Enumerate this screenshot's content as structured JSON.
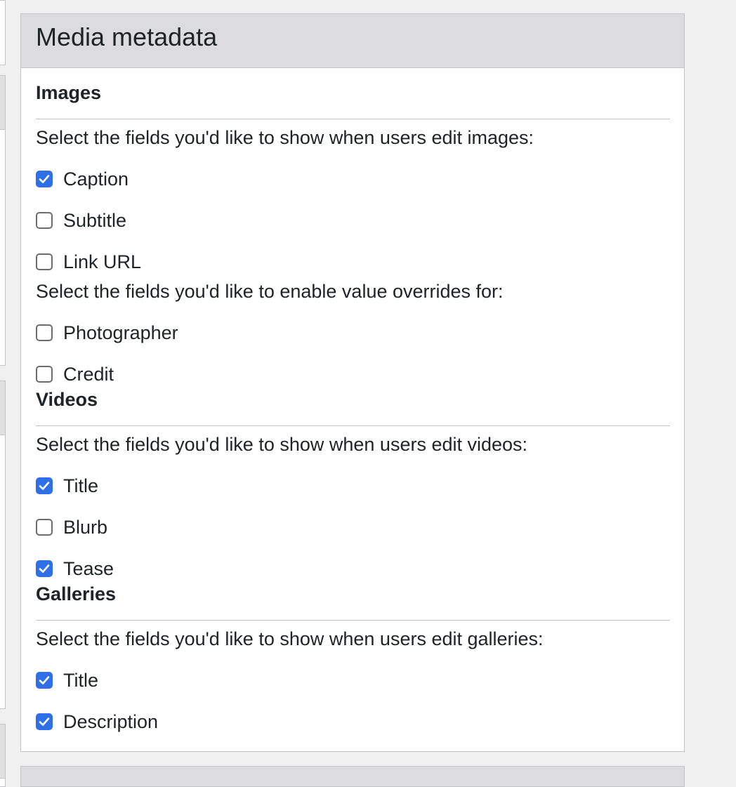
{
  "panel": {
    "title": "Media metadata"
  },
  "images": {
    "heading": "Images",
    "show_prompt": "Select the fields you'd like to show when users edit images:",
    "show_options": [
      {
        "label": "Caption",
        "checked": true
      },
      {
        "label": "Subtitle",
        "checked": false
      },
      {
        "label": "Link URL",
        "checked": false
      }
    ],
    "override_prompt": "Select the fields you'd like to enable value overrides for:",
    "override_options": [
      {
        "label": "Photographer",
        "checked": false
      },
      {
        "label": "Credit",
        "checked": false
      }
    ]
  },
  "videos": {
    "heading": "Videos",
    "show_prompt": "Select the fields you'd like to show when users edit videos:",
    "show_options": [
      {
        "label": "Title",
        "checked": true
      },
      {
        "label": "Blurb",
        "checked": false
      },
      {
        "label": "Tease",
        "checked": true
      }
    ]
  },
  "galleries": {
    "heading": "Galleries",
    "show_prompt": "Select the fields you'd like to show when users edit galleries:",
    "show_options": [
      {
        "label": "Title",
        "checked": true
      },
      {
        "label": "Description",
        "checked": true
      }
    ]
  },
  "colors": {
    "checkbox_checked": "#2f6fe8",
    "header_bg": "#dcdcde",
    "border": "#c3c4c7"
  }
}
